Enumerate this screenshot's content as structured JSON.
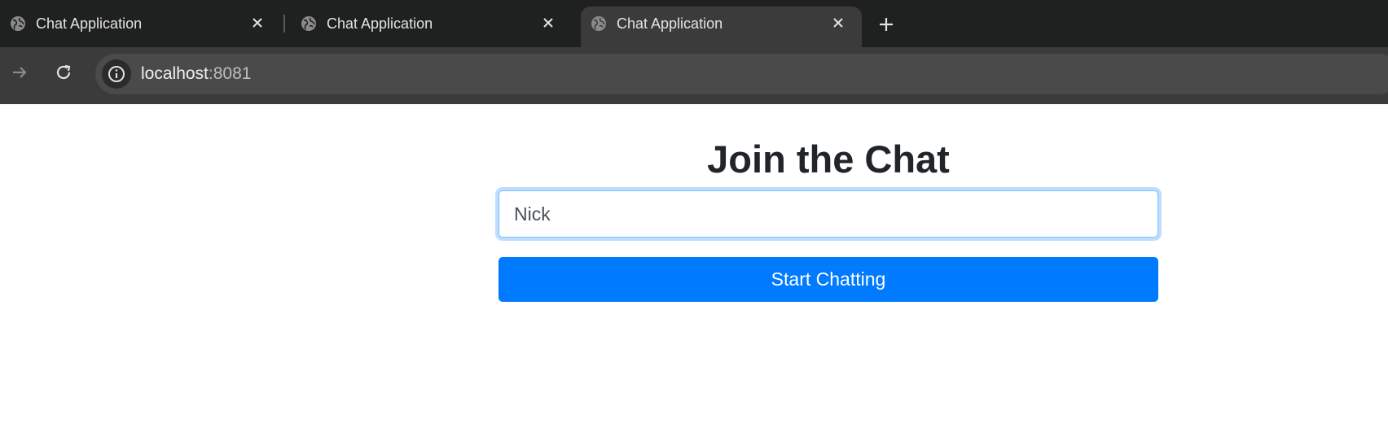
{
  "browser": {
    "tabs": [
      {
        "title": "Chat Application",
        "icon": "globe-icon",
        "active": false
      },
      {
        "title": "Chat Application",
        "icon": "globe-icon",
        "active": false
      },
      {
        "title": "Chat Application",
        "icon": "globe-icon",
        "active": true
      }
    ],
    "address": {
      "host": "localhost",
      "port": ":8081"
    }
  },
  "page": {
    "heading": "Join the Chat",
    "name_input": {
      "value": "Nick",
      "placeholder": ""
    },
    "start_button": "Start Chatting"
  },
  "colors": {
    "tabstrip_bg": "#1f2020",
    "toolbar_bg": "#3b3b3b",
    "primary_button": "#007bff",
    "heading_text": "#212529"
  }
}
